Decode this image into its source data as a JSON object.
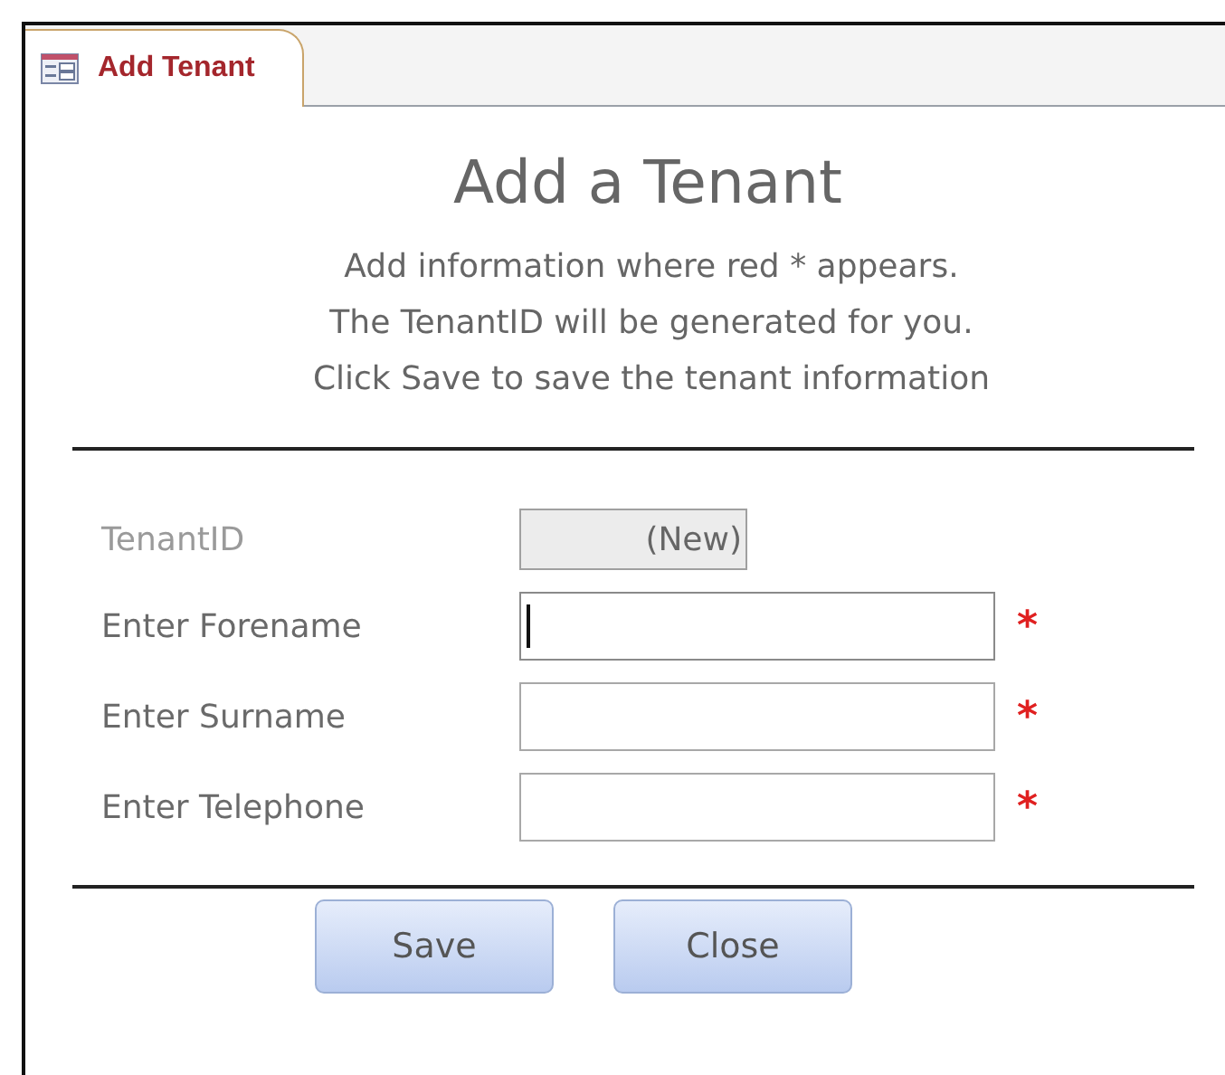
{
  "tab": {
    "label": "Add Tenant",
    "selected": true
  },
  "title": "Add a Tenant",
  "instructions": [
    "Add information where red * appears.",
    "The TenantID will be generated for you.",
    "Click Save to save the tenant information"
  ],
  "fields": [
    {
      "label": "TenantID",
      "kind": "readonly",
      "value": "(New)",
      "required": false
    },
    {
      "label": "Enter Forename",
      "kind": "text",
      "required": true,
      "focused": true
    },
    {
      "label": "Enter Surname",
      "kind": "text",
      "required": true,
      "focused": false
    },
    {
      "label": "Enter Telephone",
      "kind": "text",
      "required": true,
      "focused": false
    }
  ],
  "required_mark": "*",
  "buttons": [
    "Save",
    "Close"
  ]
}
